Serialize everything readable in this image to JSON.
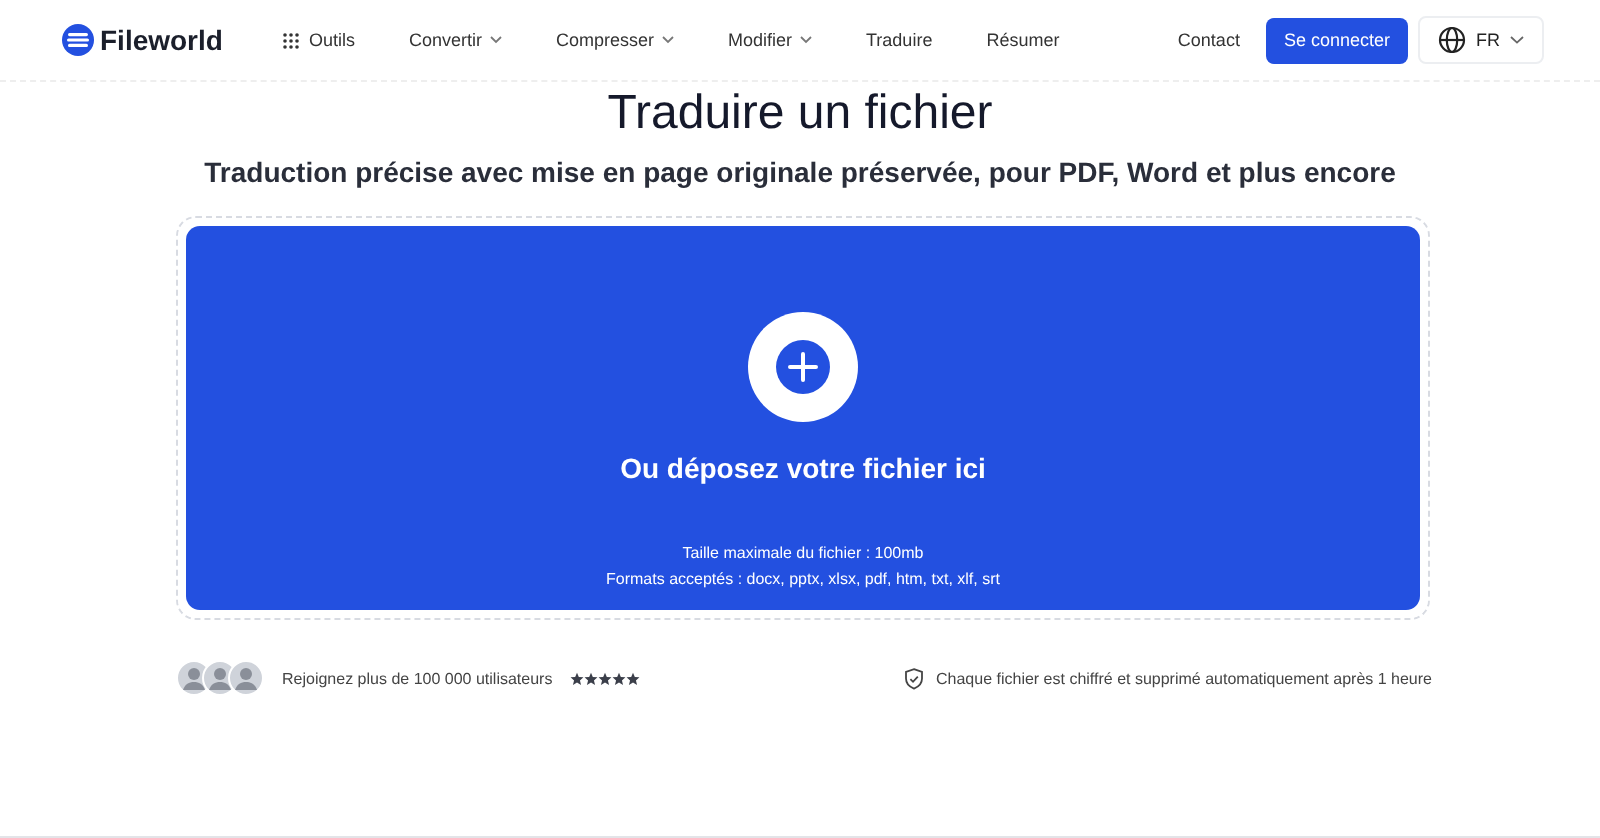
{
  "header": {
    "logo": "Fileworld",
    "nav": [
      {
        "label": "Outils",
        "kind": "grid"
      },
      {
        "label": "Convertir",
        "kind": "menu"
      },
      {
        "label": "Compresser",
        "kind": "menu"
      },
      {
        "label": "Modifier",
        "kind": "menu"
      },
      {
        "label": "Traduire",
        "kind": "link"
      },
      {
        "label": "Résumer",
        "kind": "link"
      }
    ],
    "contact": "Contact",
    "login": "Se connecter",
    "language": "FR"
  },
  "title": "Traduire un fichier",
  "subtitle": "Traduction précise avec mise en page originale préservée, pour PDF, Word et plus encore",
  "dropzone": {
    "prompt": "Ou déposez votre fichier ici",
    "max_size": "Taille maximale du fichier : 100mb",
    "formats": "Formats acceptés : docx, pptx, xlsx, pdf, htm, txt, xlf, srt"
  },
  "social": {
    "text": "Rejoignez plus de 100 000 utilisateurs",
    "stars": 5
  },
  "security": "Chaque fichier est chiffré et supprimé automatiquement après 1 heure"
}
